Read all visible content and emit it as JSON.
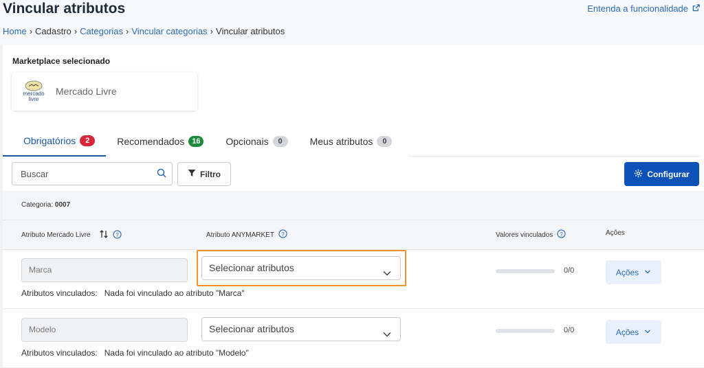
{
  "header": {
    "title": "Vincular atributos",
    "help_link": "Entenda a funcionalidade",
    "breadcrumb": [
      "Home",
      "Cadastro",
      "Categorias",
      "Vincular categorias",
      "Vincular atributos"
    ]
  },
  "marketplace": {
    "label": "Marketplace selecionado",
    "name": "Mercado Livre",
    "logo_text_1": "mercado",
    "logo_text_2": "livre"
  },
  "tabs": [
    {
      "label": "Obrigatórios",
      "count": "2",
      "color": "#d9263a"
    },
    {
      "label": "Recomendados",
      "count": "16",
      "color": "#1e8a3c"
    },
    {
      "label": "Opcionais",
      "count": "0",
      "color": "#d3d6da"
    },
    {
      "label": "Meus atributos",
      "count": "0",
      "color": "#d3d6da"
    }
  ],
  "toolbar": {
    "search_placeholder": "Buscar",
    "filter_label": "Filtro",
    "config_label": "Configurar"
  },
  "category": {
    "label": "Categoria:",
    "value": "0007"
  },
  "table": {
    "columns": {
      "ml_attr": "Atributo Mercado Livre",
      "any_attr": "Atributo ANYMARKET",
      "values": "Valores vinculados",
      "actions": "Ações"
    },
    "rows": [
      {
        "ml_value": "Marca",
        "select_placeholder": "Selecionar atributos",
        "ratio": "0/0",
        "progress": 0,
        "actions_label": "Ações",
        "linked_label": "Atributos vinculados:",
        "linked_value": "Nada foi vinculado ao atributo \"Marca\""
      },
      {
        "ml_value": "Modelo",
        "select_placeholder": "Selecionar atributos",
        "ratio": "0/0",
        "progress": 0,
        "actions_label": "Ações",
        "linked_label": "Atributos vinculados:",
        "linked_value": "Nada foi vinculado ao atributo \"Modelo\""
      }
    ]
  },
  "colors": {
    "accent": "#0d52b8",
    "link": "#2a6bb8",
    "highlight": "#f2902b"
  }
}
